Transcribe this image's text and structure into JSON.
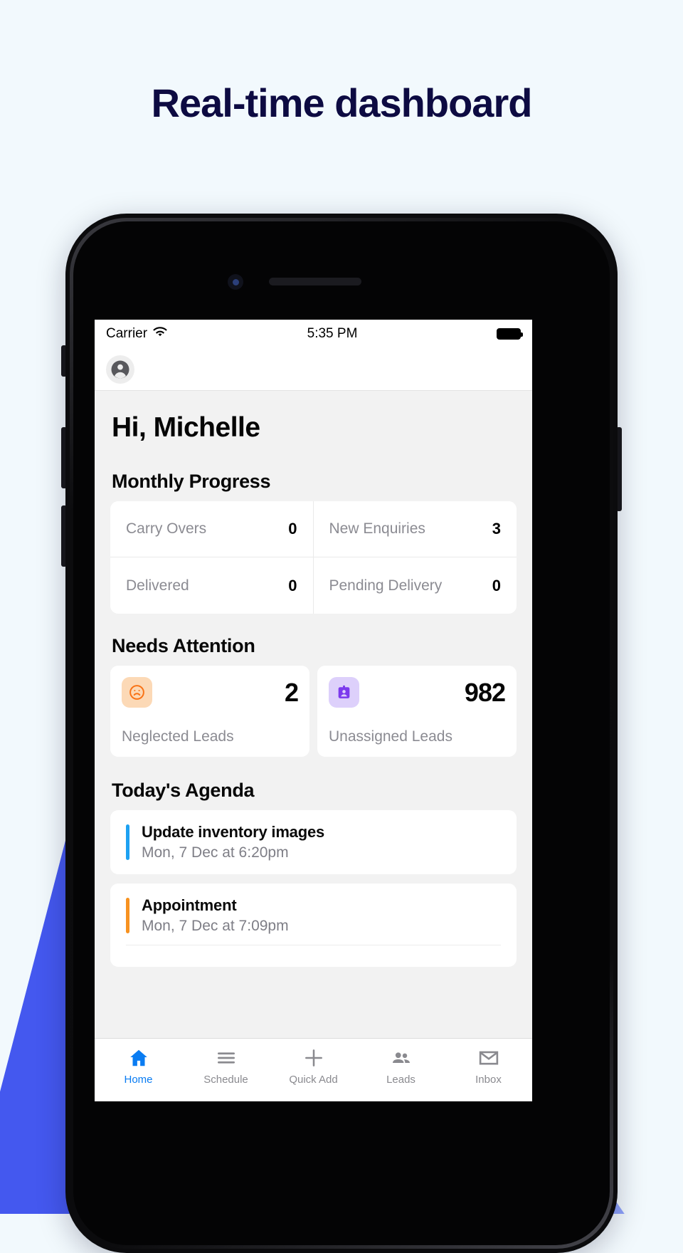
{
  "headline": "Real-time dashboard",
  "colors": {
    "page_bg": "#f2f9fd",
    "headline": "#0d0b42",
    "accent_blue": "#4458ef",
    "accent_blue_light": "#8da2fb",
    "tab_active": "#0a7cf2",
    "neglected_icon": "#f97316",
    "neglected_icon_bg": "#fcd9b6",
    "unassigned_icon": "#7c3aed",
    "unassigned_icon_bg": "#ddd0fb",
    "agenda_bar_1": "#1da1f2",
    "agenda_bar_2": "#f79220"
  },
  "statusbar": {
    "carrier": "Carrier",
    "wifi_icon": "wifi-icon",
    "time": "5:35 PM",
    "battery_icon": "battery-full-icon"
  },
  "navbar": {
    "avatar_icon": "account-circle-icon"
  },
  "greeting": "Hi, Michelle",
  "monthly_progress": {
    "title": "Monthly Progress",
    "stats": [
      {
        "label": "Carry Overs",
        "value": "0"
      },
      {
        "label": "New Enquiries",
        "value": "3"
      },
      {
        "label": "Delivered",
        "value": "0"
      },
      {
        "label": "Pending Delivery",
        "value": "0"
      }
    ]
  },
  "needs_attention": {
    "title": "Needs Attention",
    "cards": [
      {
        "icon": "sad-face-icon",
        "value": "2",
        "label": "Neglected Leads"
      },
      {
        "icon": "id-badge-icon",
        "value": "982",
        "label": "Unassigned Leads"
      }
    ]
  },
  "todays_agenda": {
    "title": "Today's Agenda",
    "items": [
      {
        "title": "Update inventory images",
        "subtitle": "Mon, 7 Dec at 6:20pm"
      },
      {
        "title": "Appointment",
        "subtitle": "Mon, 7 Dec at 7:09pm"
      }
    ]
  },
  "tabbar": {
    "tabs": [
      {
        "label": "Home",
        "icon": "home-icon",
        "active": true
      },
      {
        "label": "Schedule",
        "icon": "menu-lines-icon",
        "active": false
      },
      {
        "label": "Quick Add",
        "icon": "plus-icon",
        "active": false
      },
      {
        "label": "Leads",
        "icon": "people-icon",
        "active": false
      },
      {
        "label": "Inbox",
        "icon": "envelope-icon",
        "active": false
      }
    ]
  }
}
